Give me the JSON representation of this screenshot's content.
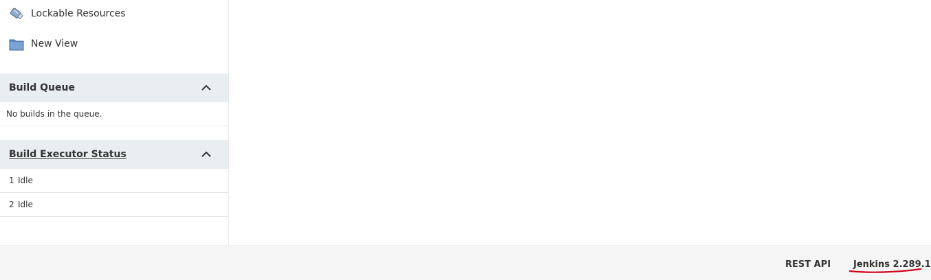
{
  "sidebar": {
    "tasks": [
      {
        "label": "Lockable Resources",
        "icon": "lockable-resources-icon"
      },
      {
        "label": "New View",
        "icon": "folder-icon"
      }
    ]
  },
  "build_queue": {
    "title": "Build Queue",
    "empty_message": "No builds in the queue."
  },
  "executor_status": {
    "title": "Build Executor Status",
    "executors": [
      {
        "number": "1",
        "status": "Idle"
      },
      {
        "number": "2",
        "status": "Idle"
      }
    ]
  },
  "footer": {
    "rest_api_label": "REST API",
    "version_label": "Jenkins 2.289.1"
  },
  "colors": {
    "pane_header_bg": "#e9eef1",
    "footer_bg": "#f5f5f5",
    "annotation_red": "#d0021b"
  }
}
